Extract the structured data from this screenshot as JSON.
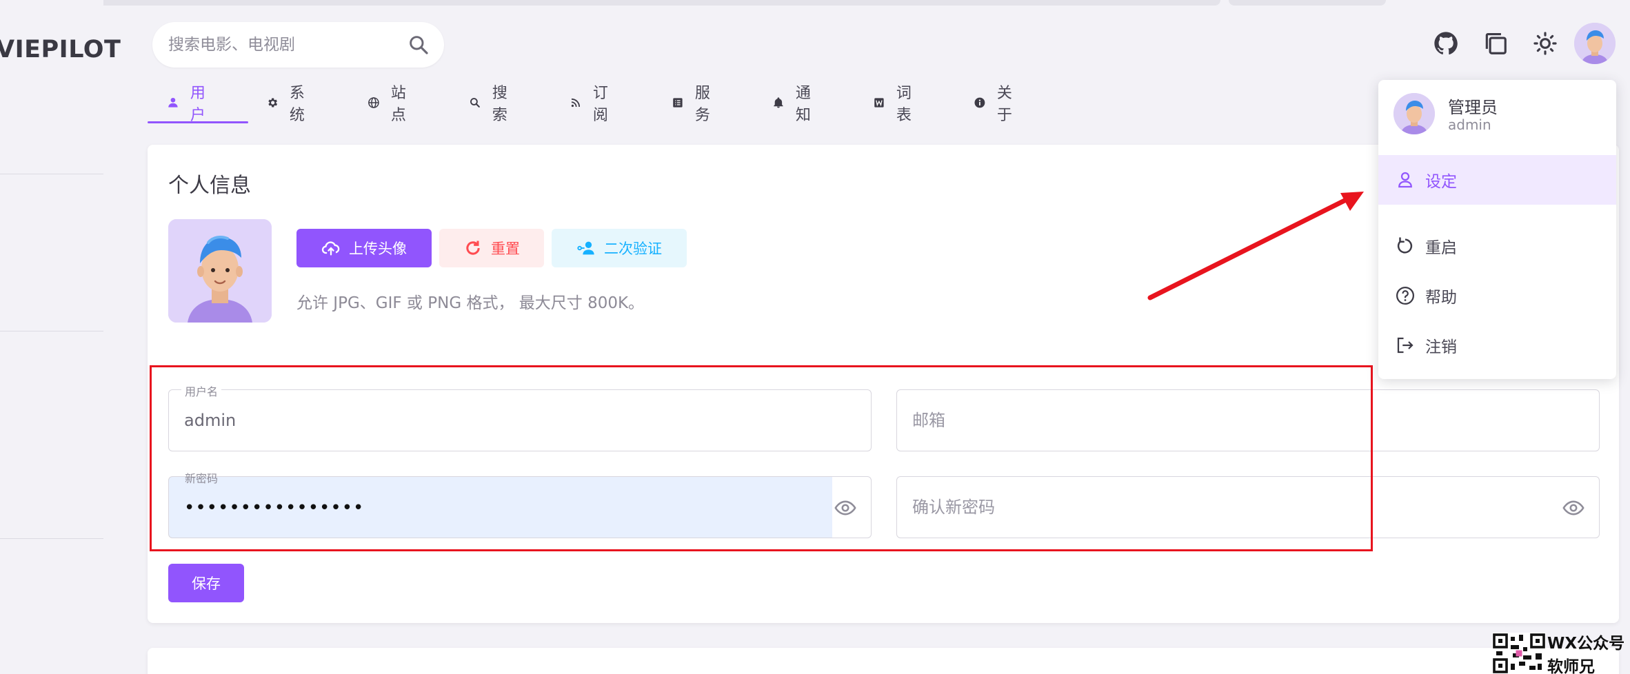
{
  "app": {
    "logo_text": "VIEPILOT"
  },
  "search": {
    "placeholder": "搜索电影、电视剧"
  },
  "tabs": [
    {
      "label": "用户",
      "icon": "user-icon"
    },
    {
      "label": "系统",
      "icon": "gear-icon"
    },
    {
      "label": "站点",
      "icon": "globe-icon"
    },
    {
      "label": "搜索",
      "icon": "search-icon"
    },
    {
      "label": "订阅",
      "icon": "rss-icon"
    },
    {
      "label": "服务",
      "icon": "list-icon"
    },
    {
      "label": "通知",
      "icon": "bell-icon"
    },
    {
      "label": "词表",
      "icon": "w-icon"
    },
    {
      "label": "关于",
      "icon": "info-icon"
    }
  ],
  "profile": {
    "title": "个人信息",
    "upload_label": "上传头像",
    "reset_label": "重置",
    "twofa_label": "二次验证",
    "hint": "允许 JPG、GIF 或 PNG 格式， 最大尺寸 800K。",
    "username_label": "用户名",
    "username_value": "admin",
    "email_placeholder": "邮箱",
    "password_label": "新密码",
    "password_mask": "••••••••••••••••",
    "confirm_placeholder": "确认新密码",
    "save_label": "保存"
  },
  "menu": {
    "name": "管理员",
    "username": "admin",
    "items": [
      {
        "label": "设定",
        "icon": "person-icon"
      },
      {
        "label": "重启",
        "icon": "restart-icon"
      },
      {
        "label": "帮助",
        "icon": "help-icon"
      },
      {
        "label": "注销",
        "icon": "logout-icon"
      }
    ]
  },
  "watermark": {
    "line1": "WX公众号",
    "line2": "软师兄"
  },
  "colors": {
    "primary": "#9155fd",
    "error": "#ff4c51",
    "info": "#16b1ff",
    "annotation": "#e8141e"
  }
}
